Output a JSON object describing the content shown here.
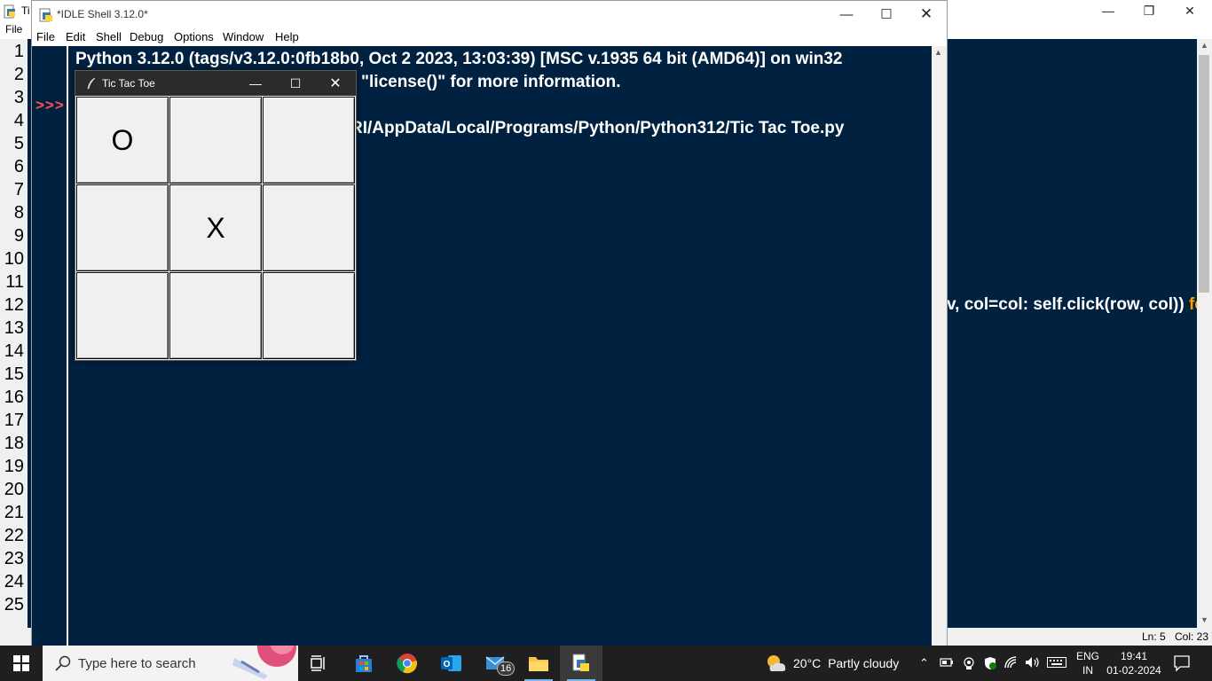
{
  "bg_window": {
    "title": "Ti",
    "menu_file": "File",
    "code_fragment": "v, col=col: self.click(row, col))",
    "code_fragment_kw": "fo",
    "status_ln": "Ln: 5",
    "status_col": "Col: 23"
  },
  "line_numbers": [
    "1",
    "2",
    "3",
    "4",
    "5",
    "6",
    "7",
    "8",
    "9",
    "10",
    "11",
    "12",
    "13",
    "14",
    "15",
    "16",
    "17",
    "18",
    "19",
    "20",
    "21",
    "22",
    "23",
    "24",
    "25"
  ],
  "shell": {
    "title": "*IDLE Shell 3.12.0*",
    "menu": [
      "File",
      "Edit",
      "Shell",
      "Debug",
      "Options",
      "Window",
      "Help"
    ],
    "prompt": ">>>",
    "line1": "Python 3.12.0 (tags/v3.12.0:0fb18b0, Oct  2 2023, 13:03:39) [MSC v.1935 64 bit (AMD64)] on win32",
    "line2": "\"license()\" for more information.",
    "line3": "RI/AppData/Local/Programs/Python/Python312/Tic Tac Toe.py"
  },
  "ttt": {
    "title": "Tic Tac Toe",
    "board": [
      "O",
      "",
      "",
      "",
      "X",
      "",
      "",
      "",
      ""
    ]
  },
  "taskbar": {
    "search_placeholder": "Type here to search",
    "mail_badge": "16",
    "weather_temp": "20°C",
    "weather_desc": "Partly cloudy",
    "lang_line1": "ENG",
    "lang_line2": "IN",
    "time": "19:41",
    "date": "01-02-2024"
  }
}
